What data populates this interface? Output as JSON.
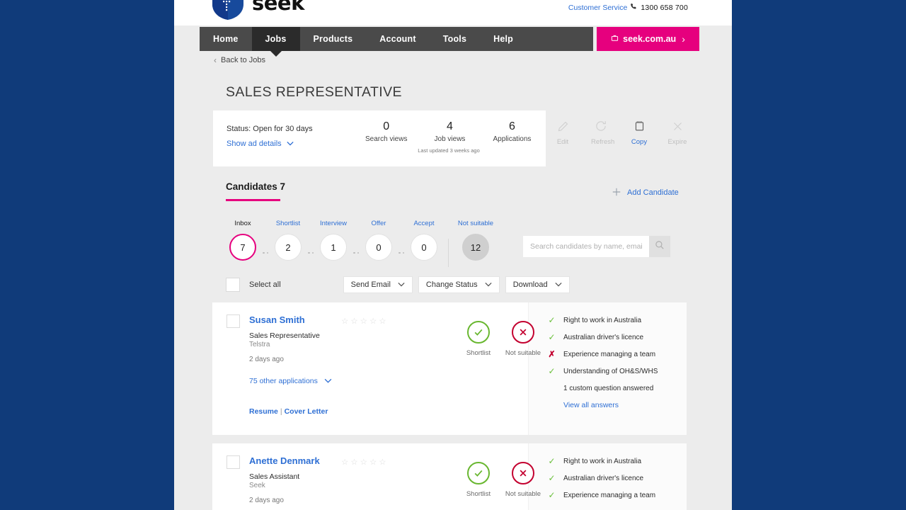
{
  "header": {
    "logo_text": "seek",
    "customer_service_label": "Customer Service",
    "phone": "1300 658 700"
  },
  "nav": {
    "items": [
      {
        "label": "Home",
        "active": false
      },
      {
        "label": "Jobs",
        "active": true
      },
      {
        "label": "Products",
        "active": false
      },
      {
        "label": "Account",
        "active": false
      },
      {
        "label": "Tools",
        "active": false
      },
      {
        "label": "Help",
        "active": false
      }
    ],
    "cta_label": "seek.com.au",
    "cta_chevron": "›"
  },
  "breadcrumb": {
    "back_label": "Back to Jobs",
    "chevron": "‹"
  },
  "page_title": "SALES REPRESENTATIVE",
  "status_card": {
    "status_text": "Status: Open for 30 days",
    "show_ad_label": "Show ad details",
    "chevron_down": "⌄",
    "stats": [
      {
        "value": "0",
        "label": "Search views"
      },
      {
        "value": "4",
        "label": "Job views"
      },
      {
        "value": "6",
        "label": "Applications"
      }
    ],
    "last_updated": "Last updated 3 weeks ago",
    "actions": [
      {
        "label": "Edit",
        "icon": "pencil-icon",
        "state": "disabled"
      },
      {
        "label": "Refresh",
        "icon": "refresh-icon",
        "state": "disabled"
      },
      {
        "label": "Copy",
        "icon": "copy-icon",
        "state": "active"
      },
      {
        "label": "Expire",
        "icon": "close-icon",
        "state": "disabled"
      }
    ]
  },
  "candidates": {
    "title": "Candidates 7",
    "add_label": "Add Candidate",
    "add_icon": "plus-icon",
    "pipeline": [
      {
        "label": "Inbox",
        "count": "7",
        "selected": true,
        "grey": false
      },
      {
        "label": "Shortlist",
        "count": "2",
        "selected": false,
        "grey": false
      },
      {
        "label": "Interview",
        "count": "1",
        "selected": false,
        "grey": false
      },
      {
        "label": "Offer",
        "count": "0",
        "selected": false,
        "grey": false
      },
      {
        "label": "Accept",
        "count": "0",
        "selected": false,
        "grey": false
      },
      {
        "label": "Not suitable",
        "count": "12",
        "selected": false,
        "grey": true
      }
    ],
    "search": {
      "placeholder": "Search candidates by name, email...",
      "value": "",
      "icon": "search-icon"
    },
    "bulk": {
      "select_all_label": "Select all",
      "dropdowns": [
        {
          "label": "Send Email"
        },
        {
          "label": "Change Status"
        },
        {
          "label": "Download"
        }
      ],
      "chevron_down": "⌄"
    },
    "list": [
      {
        "name": "Susan Smith",
        "role": "Sales Representative",
        "company": "Telstra",
        "time": "2 days ago",
        "other_applications": "75 other applications",
        "stars": 0,
        "resume_label": "Resume",
        "cover_letter_label": "Cover Letter",
        "separator": "|",
        "shortlist_label": "Shortlist",
        "not_suitable_label": "Not suitable",
        "answers": [
          {
            "status": "yes",
            "text": "Right to work in Australia"
          },
          {
            "status": "yes",
            "text": "Australian driver's licence"
          },
          {
            "status": "no",
            "text": "Experience managing a team"
          },
          {
            "status": "yes",
            "text": "Understanding of OH&S/WHS"
          },
          {
            "status": "none",
            "text": "1 custom question answered"
          }
        ],
        "view_all_label": "View all answers"
      },
      {
        "name": "Anette Denmark",
        "role": "Sales Assistant",
        "company": "Seek",
        "time": "2 days ago",
        "stars": 0,
        "shortlist_label": "Shortlist",
        "not_suitable_label": "Not suitable",
        "answers": [
          {
            "status": "yes",
            "text": "Right to work in Australia"
          },
          {
            "status": "yes",
            "text": "Australian driver's licence"
          },
          {
            "status": "yes",
            "text": "Experience managing a team"
          }
        ]
      }
    ]
  },
  "colors": {
    "brand_pink": "#E6007E",
    "nav_dark": "#4A4A4A",
    "nav_active": "#2B2B2B",
    "link_blue": "#2e6fd4",
    "backdrop_navy": "#103B7A",
    "success_green": "#69B730",
    "danger_red": "#C3002F"
  }
}
